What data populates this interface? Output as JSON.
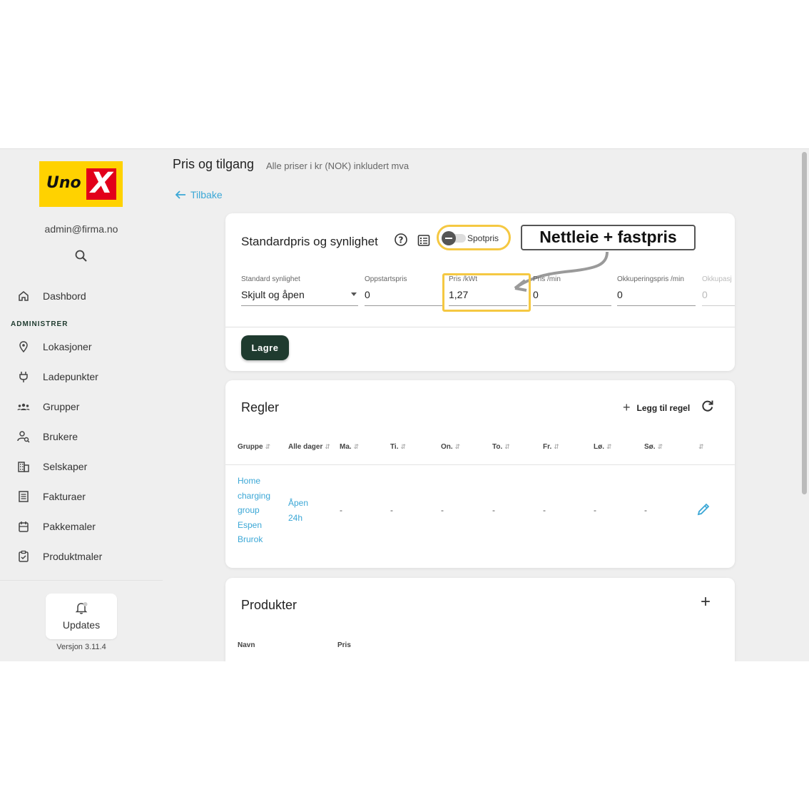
{
  "sidebar": {
    "logo": {
      "text": "Uno",
      "mark": "X"
    },
    "user_email": "admin@firma.no",
    "nav_top": [
      {
        "label": "Dashbord",
        "icon": "home-icon"
      }
    ],
    "section_label": "ADMINISTRER",
    "nav_admin": [
      {
        "label": "Lokasjoner",
        "icon": "location-pin-icon"
      },
      {
        "label": "Ladepunkter",
        "icon": "plug-icon"
      },
      {
        "label": "Grupper",
        "icon": "groups-icon"
      },
      {
        "label": "Brukere",
        "icon": "user-search-icon"
      },
      {
        "label": "Selskaper",
        "icon": "building-icon"
      },
      {
        "label": "Fakturaer",
        "icon": "invoice-icon"
      },
      {
        "label": "Pakkemaler",
        "icon": "package-icon"
      },
      {
        "label": "Produktmaler",
        "icon": "clipboard-icon"
      }
    ],
    "updates_label": "Updates",
    "version": "Versjon 3.11.4"
  },
  "header": {
    "title": "Pris og tilgang",
    "subtitle": "Alle priser i kr (NOK) inkludert mva",
    "back_label": "Tilbake"
  },
  "standard": {
    "title": "Standardpris og synlighet",
    "spot_toggle_label": "Spotpris",
    "spot_toggle_on": false,
    "annotation": "Nettleie + fastpris",
    "fields": {
      "visibility": {
        "label": "Standard synlighet",
        "value": "Skjult og åpen"
      },
      "startup": {
        "label": "Oppstartspris",
        "value": "0"
      },
      "per_kwh": {
        "label": "Pris /kWt",
        "value": "1,27"
      },
      "per_min": {
        "label": "Pris /min",
        "value": "0"
      },
      "occupancy": {
        "label": "Okkuperingspris /min",
        "value": "0"
      },
      "occupancy2": {
        "label": "Okkupasj",
        "value": "0"
      }
    },
    "save_label": "Lagre"
  },
  "rules": {
    "title": "Regler",
    "add_label": "Legg til regel",
    "columns": [
      "Gruppe",
      "Alle dager",
      "Ma.",
      "Ti.",
      "On.",
      "To.",
      "Fr.",
      "Lø.",
      "Sø."
    ],
    "rows": [
      {
        "group": "Home charging group Espen Brurok",
        "all_days": "Åpen 24h",
        "days": [
          "-",
          "-",
          "-",
          "-",
          "-",
          "-",
          "-"
        ]
      }
    ],
    "colors": {
      "accent": "#3ba7d6"
    }
  },
  "products": {
    "title": "Produkter",
    "columns": [
      "Navn",
      "Pris"
    ]
  },
  "theme": {
    "brand_yellow": "#ffd200",
    "brand_red": "#e2001a",
    "primary_dark": "#1f3b2f",
    "highlight": "#f5c842"
  }
}
